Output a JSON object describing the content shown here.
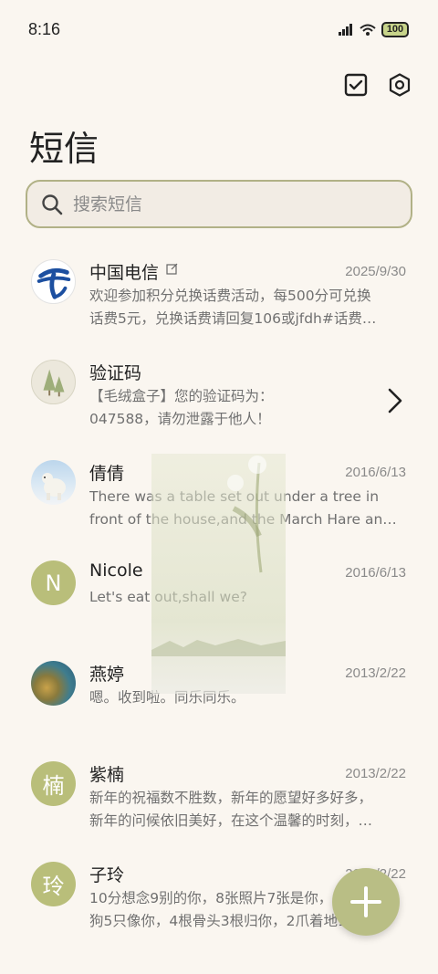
{
  "status_bar": {
    "time": "8:16",
    "battery": "100"
  },
  "header": {
    "title": "短信",
    "select_icon": "checkbox-icon",
    "settings_icon": "hexagon-settings-icon"
  },
  "search": {
    "placeholder": "搜索短信"
  },
  "messages": [
    {
      "sender": "中国电信",
      "date": "2025/9/30",
      "line1": "欢迎参加积分兑换话费活动，每500分可兑换",
      "line2": "话费5元，兑换话费请回复106或jfdh#话费…",
      "avatar": "china-telecom-logo"
    },
    {
      "sender": "验证码",
      "date": "",
      "line1": "【毛绒盒子】您的验证码为：",
      "line2": "047588，请勿泄露于他人！",
      "avatar": "tree-icon"
    },
    {
      "sender": "倩倩",
      "date": "2016/6/13",
      "line1": "There was a table set out under a tree in",
      "line2": "front of the house,and the March Hare an…",
      "avatar": "polar-bear-photo"
    },
    {
      "sender": "Nicole",
      "date": "2016/6/13",
      "line1": "Let's eat out,shall we?",
      "line2": "",
      "avatar_letter": "N"
    },
    {
      "sender": "燕婷",
      "date": "2013/2/22",
      "line1": "嗯。收到啦。同乐同乐。",
      "line2": "",
      "avatar": "landscape-photo"
    },
    {
      "sender": "紫楠",
      "date": "2013/2/22",
      "line1": "新年的祝福数不胜数，新年的愿望好多好多，",
      "line2": "新年的问候依旧美好，在这个温馨的时刻，…",
      "avatar_letter": "楠"
    },
    {
      "sender": "子玲",
      "date": "2013/2/22",
      "line1": "10分想念9别的你，8张照片7张是你，6只小",
      "line2": "狗5只像你，4根骨头3根归你，2爪着地1宝…",
      "avatar_letter": "玲"
    }
  ],
  "fab": {
    "icon": "plus-icon"
  },
  "colors": {
    "background": "#faf6f0",
    "accent": "#b9be7a",
    "search_border": "#b1b186"
  }
}
